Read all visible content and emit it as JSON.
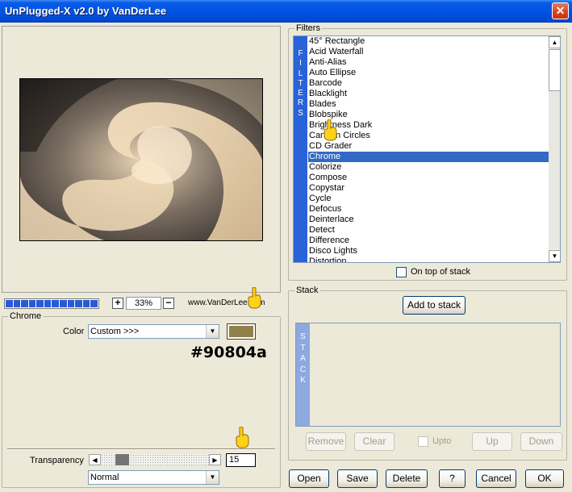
{
  "window": {
    "title": "UnPlugged-X v2.0 by VanDerLee",
    "close_glyph": "✕"
  },
  "zoom": {
    "minus": "−",
    "plus": "+",
    "value": "33%",
    "site": "www.VanDerLee.com"
  },
  "progress_segments": 12,
  "chrome_panel": {
    "title": "Chrome",
    "color_label": "Color",
    "color_value": "Custom >>>",
    "swatch_color": "#90804a",
    "hex_annotation": "#90804a",
    "transparency_label": "Transparency",
    "transparency_value": "15",
    "blend_mode": "Normal"
  },
  "filters": {
    "title": "Filters",
    "vertical_label": "FILTERS",
    "items": [
      "45° Rectangle",
      "Acid Waterfall",
      "Anti-Alias",
      "Auto Ellipse",
      "Barcode",
      "Blacklight",
      "Blades",
      "Blobspike",
      "Brightness Dark",
      "Cartoon Circles",
      "CD Grader",
      "Chrome",
      "Colorize",
      "Compose",
      "Copystar",
      "Cycle",
      "Defocus",
      "Deinterlace",
      "Detect",
      "Difference",
      "Disco Lights",
      "Distortion"
    ],
    "selected": "Chrome",
    "on_top_label": "On top of stack"
  },
  "stack": {
    "title": "Stack",
    "add_label": "Add to stack",
    "vertical_label": "STACK",
    "remove_label": "Remove",
    "clear_label": "Clear",
    "upto_label": "Upto",
    "up_label": "Up",
    "down_label": "Down"
  },
  "footer": {
    "open": "Open",
    "save": "Save",
    "delete": "Delete",
    "help": "?",
    "cancel": "Cancel",
    "ok": "OK"
  },
  "icons": {
    "pointer": "pointing-hand-icon"
  }
}
